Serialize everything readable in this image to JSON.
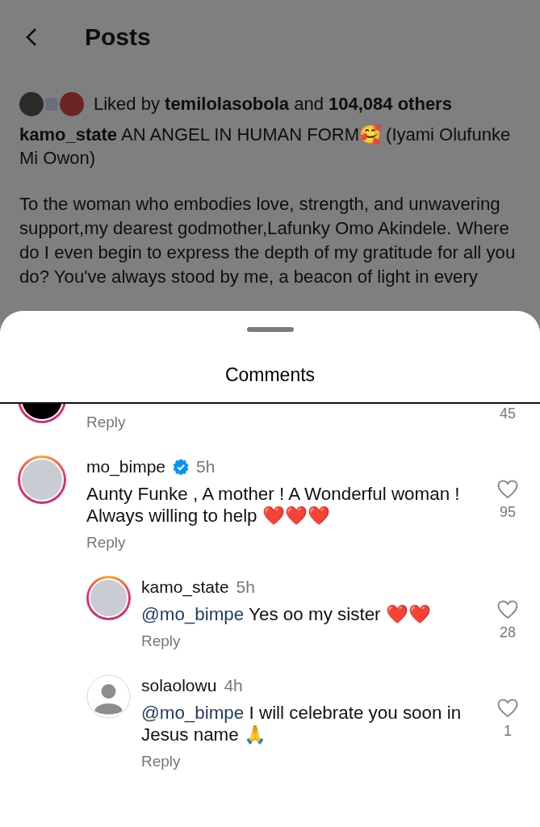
{
  "header": {
    "title": "Posts"
  },
  "post": {
    "likes": "Liked by **temilolasobola** and **104,084 others**",
    "caption_user": "kamo_state",
    "caption": "AN ANGEL IN HUMAN FORM🥰 (Iyami Olufunke Mi Owon)",
    "body": "To the woman who embodies love, strength, and unwavering support,my dearest godmother,Lafunky Omo Akindele. Where do I even begin to express the depth of my gratitude for all you do? You've always stood by me, a beacon of light in every"
  },
  "sheet": {
    "title": "Comments"
  },
  "comments": [
    {
      "kind": "cut",
      "likes": "45",
      "reply_label": "Reply"
    },
    {
      "kind": "comment",
      "avatar": {
        "kind": "photo"
      },
      "user": "mo_bimpe",
      "verified": true,
      "time": "5h",
      "text": "Aunty Funke , A mother ! A Wonderful woman ! Always willing to help",
      "emoji": "❤️❤️❤️",
      "likes": "95",
      "reply_label": "Reply"
    },
    {
      "kind": "reply",
      "avatar": {
        "kind": "photo"
      },
      "user": "kamo_state",
      "verified": false,
      "time": "5h",
      "mention": "@mo_bimpe",
      "text": "Yes oo my sister",
      "emoji": "❤️❤️",
      "likes": "28",
      "reply_label": "Reply"
    },
    {
      "kind": "reply",
      "avatar": {
        "kind": "default"
      },
      "user": "solaolowu",
      "verified": false,
      "time": "4h",
      "mention": "@mo_bimpe",
      "text": "I will celebrate you soon in Jesus name",
      "emoji": "🙏",
      "likes": "1",
      "reply_label": "Reply"
    }
  ]
}
